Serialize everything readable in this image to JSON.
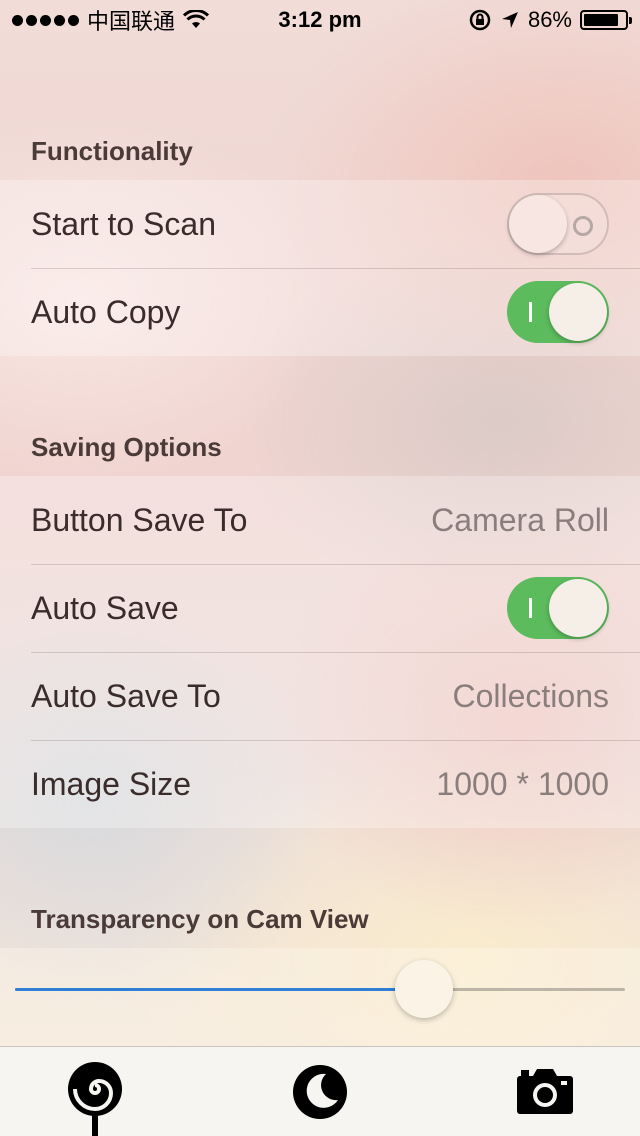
{
  "status_bar": {
    "carrier": "中国联通",
    "time": "3:12 pm",
    "battery": "86%",
    "battery_level": 0.86
  },
  "sections": {
    "functionality": {
      "title": "Functionality",
      "start_to_scan": {
        "label": "Start to Scan",
        "on": false
      },
      "auto_copy": {
        "label": "Auto Copy",
        "on": true
      }
    },
    "saving": {
      "title": "Saving Options",
      "button_save_to": {
        "label": "Button Save To",
        "value": "Camera Roll"
      },
      "auto_save": {
        "label": "Auto Save",
        "on": true
      },
      "auto_save_to": {
        "label": "Auto Save To",
        "value": "Collections"
      },
      "image_size": {
        "label": "Image Size",
        "value": "1000 * 1000"
      }
    },
    "transparency": {
      "title": "Transparency on Cam View",
      "value": 0.67
    }
  },
  "colors": {
    "switch_on": "#5cbb5c",
    "slider_fill": "#2f7fd6"
  },
  "tab_bar": {
    "icons": [
      "lollipop-icon",
      "moon-icon",
      "camera-icon"
    ]
  }
}
